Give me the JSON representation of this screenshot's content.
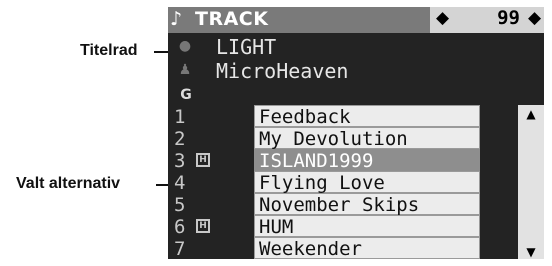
{
  "callouts": {
    "title_bar": "Titelrad",
    "selected_option": "Valt alternativ"
  },
  "header": {
    "icon": "music-note-icon",
    "icon_glyph": "♪",
    "title": "TRACK",
    "track_count": "99",
    "arrow_left": "◆",
    "arrow_right": "◆"
  },
  "info": {
    "album": "LIGHT",
    "artist": "MicroHeaven",
    "genre_glyph": "G"
  },
  "tracks": [
    {
      "num": "1",
      "name": "Feedback",
      "badge": false
    },
    {
      "num": "2",
      "name": "My Devolution",
      "badge": false
    },
    {
      "num": "3",
      "name": "ISLAND1999",
      "badge": true,
      "selected": true
    },
    {
      "num": "4",
      "name": "Flying Love",
      "badge": false
    },
    {
      "num": "5",
      "name": "November Skips",
      "badge": false
    },
    {
      "num": "6",
      "name": "HUM",
      "badge": true
    },
    {
      "num": "7",
      "name": "Weekender",
      "badge": false
    }
  ],
  "colors": {
    "screen_bg": "#232323",
    "title_bar": "#7a7a7a",
    "selected_row": "#8e8e8e",
    "row_bg": "#ececec"
  }
}
